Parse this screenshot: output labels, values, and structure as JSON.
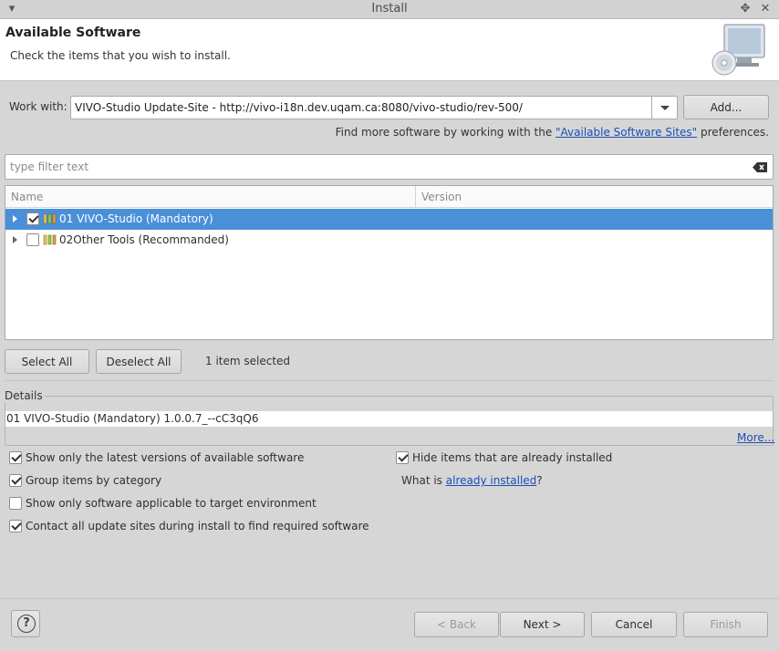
{
  "window": {
    "title": "Install"
  },
  "header": {
    "title": "Available Software",
    "subtitle": "Check the items that you wish to install."
  },
  "work_with": {
    "label": "Work with:",
    "value": "VIVO-Studio Update-Site - http://vivo-i18n.dev.uqam.ca:8080/vivo-studio/rev-500/",
    "add_label": "Add...",
    "hint_prefix": "Find more software by working with the ",
    "hint_link": "\"Available Software Sites\"",
    "hint_suffix": " preferences."
  },
  "filter": {
    "placeholder": "type filter text"
  },
  "table": {
    "columns": [
      "Name",
      "Version"
    ],
    "rows": [
      {
        "label": "01 VIVO-Studio (Mandatory)",
        "checked": true,
        "selected": true
      },
      {
        "label": "02Other Tools (Recommanded)",
        "checked": false,
        "selected": false
      }
    ]
  },
  "selection": {
    "select_all": "Select All",
    "deselect_all": "Deselect All",
    "status": "1 item selected"
  },
  "details": {
    "legend": "Details",
    "text": "01 VIVO-Studio (Mandatory) 1.0.0.7_--cC3qQ6",
    "more": "More..."
  },
  "options": {
    "latest": {
      "label": "Show only the latest versions of available software",
      "checked": true
    },
    "group": {
      "label": "Group items by category",
      "checked": true
    },
    "applicable": {
      "label": "Show only software applicable to target environment",
      "checked": false
    },
    "contact": {
      "label": "Contact all update sites during install to find required software",
      "checked": true
    },
    "hide_installed": {
      "label": "Hide items that are already installed",
      "checked": true
    },
    "what_prefix": "What is ",
    "what_link": "already installed",
    "what_suffix": "?"
  },
  "footer": {
    "back": "< Back",
    "next": "Next >",
    "cancel": "Cancel",
    "finish": "Finish"
  },
  "colors": {
    "selection": "#4a90d9",
    "link": "#1a4fb5"
  }
}
